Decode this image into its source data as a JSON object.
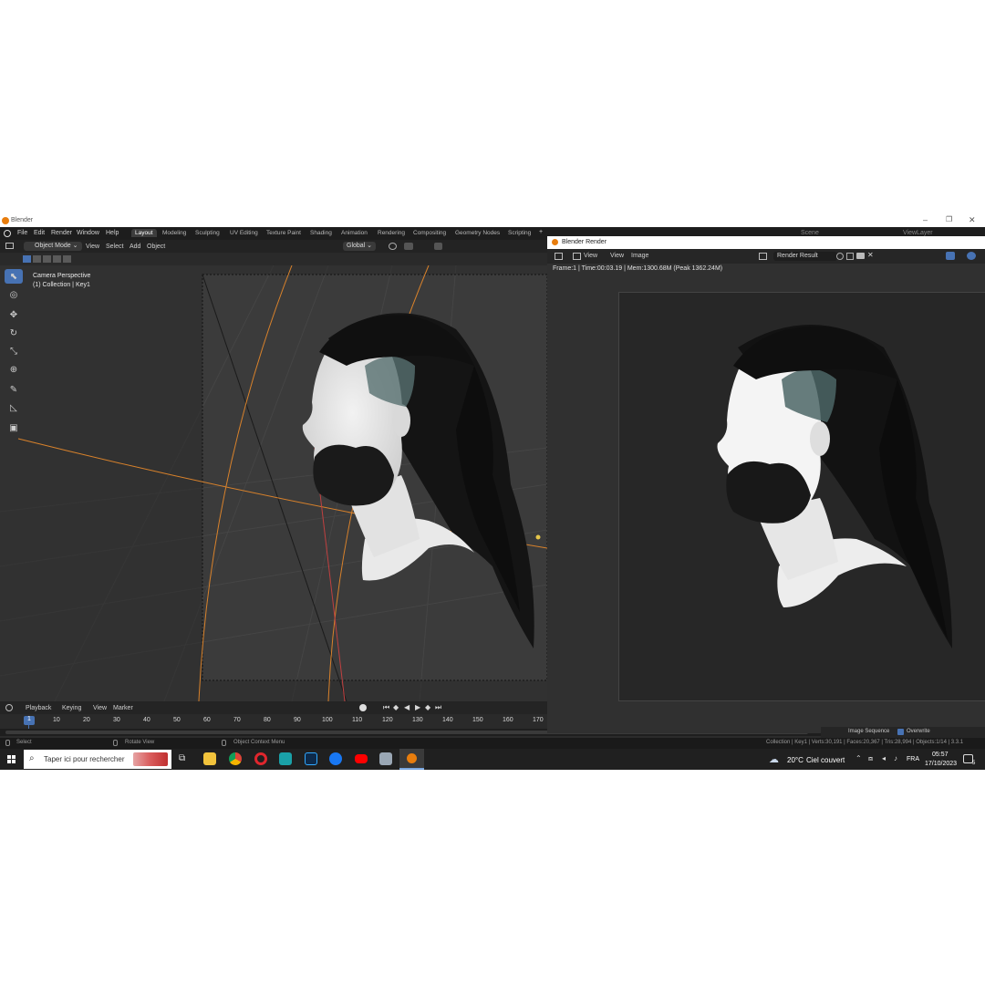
{
  "window": {
    "title": "Blender"
  },
  "menus": [
    "File",
    "Edit",
    "Render",
    "Window",
    "Help"
  ],
  "workspaces": [
    "Layout",
    "Modeling",
    "Sculpting",
    "UV Editing",
    "Texture Paint",
    "Shading",
    "Animation",
    "Rendering",
    "Compositing",
    "Geometry Nodes",
    "Scripting"
  ],
  "workspace_plus": "+",
  "scene_label": "Scene",
  "viewlayer_label": "ViewLayer",
  "viewport": {
    "mode": "Object Mode",
    "menus": [
      "View",
      "Select",
      "Add",
      "Object"
    ],
    "transform": "Global",
    "overlay_title": "Camera Perspective",
    "overlay_sub": "(1) Collection | Key1"
  },
  "render_window": {
    "title": "Blender Render",
    "menus": [
      "View",
      "View",
      "Image"
    ],
    "slot": "Render Result",
    "info": "Frame:1 | Time:00:03.19 | Mem:1300.68M (Peak 1362.24M)"
  },
  "timeline": {
    "menus": [
      "Playback",
      "Keying",
      "View",
      "Marker"
    ],
    "current_frame": "1",
    "ticks": [
      "10",
      "20",
      "30",
      "40",
      "50",
      "60",
      "70",
      "80",
      "90",
      "100",
      "110",
      "120",
      "130",
      "140",
      "150",
      "160",
      "170"
    ]
  },
  "image_sequence": {
    "label": "Image Sequence",
    "overwrite": "Overwrite"
  },
  "status": {
    "select": "Select",
    "rotate": "Rotate View",
    "context": "Object Context Menu",
    "stats": "Collection | Key1 | Verts:30,191 | Faces:20,367 | Tris:28,994 | Objects:1/14 | 3.3.1"
  },
  "taskbar": {
    "search_placeholder": "Taper ici pour rechercher",
    "weather_temp": "20°C",
    "weather_text": "Ciel couvert",
    "lang": "FRA",
    "time": "05:57",
    "date": "17/10/2023",
    "notif": "5"
  },
  "colors": {
    "accent": "#4772b3",
    "bg": "#2b2b2b",
    "header": "#1d1d1d"
  }
}
